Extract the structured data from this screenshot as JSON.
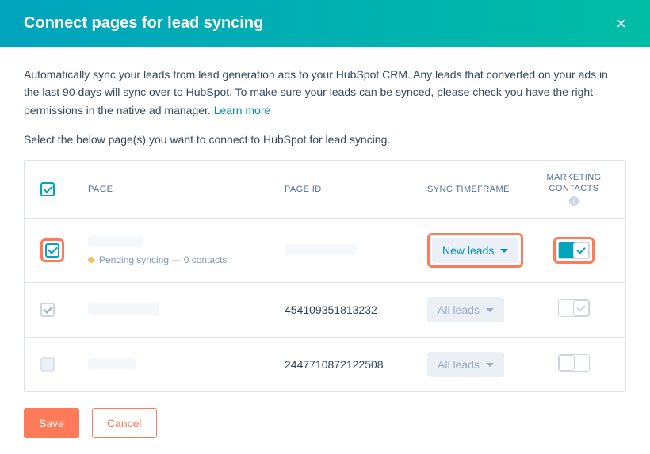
{
  "header": {
    "title": "Connect pages for lead syncing"
  },
  "description": {
    "text": "Automatically sync your leads from lead generation ads to your HubSpot CRM. Any leads that converted on your ads in the last 90 days will sync over to HubSpot. To make sure your leads can be synced, please check you have the right permissions in the native ad manager. ",
    "learn_more": "Learn more"
  },
  "subheading": "Select the below page(s) you want to connect to HubSpot for lead syncing.",
  "columns": {
    "page": "PAGE",
    "page_id": "PAGE ID",
    "sync_timeframe": "SYNC TIMEFRAME",
    "marketing_contacts": "MARKETING CONTACTS"
  },
  "rows": [
    {
      "checked": true,
      "highlighted": true,
      "pending_text": "Pending syncing — 0 contacts",
      "page_id": "",
      "sync": {
        "label": "New leads",
        "style": "active",
        "highlighted": true
      },
      "toggle": {
        "state": "on",
        "highlighted": true
      }
    },
    {
      "checked": true,
      "grey_check": true,
      "page_id": "454109351813232",
      "sync": {
        "label": "All leads",
        "style": "disabled"
      },
      "toggle": {
        "state": "mid"
      }
    },
    {
      "checked": false,
      "page_id": "2447710872122508",
      "sync": {
        "label": "All leads",
        "style": "disabled"
      },
      "toggle": {
        "state": "off"
      }
    }
  ],
  "buttons": {
    "save": "Save",
    "cancel": "Cancel"
  }
}
